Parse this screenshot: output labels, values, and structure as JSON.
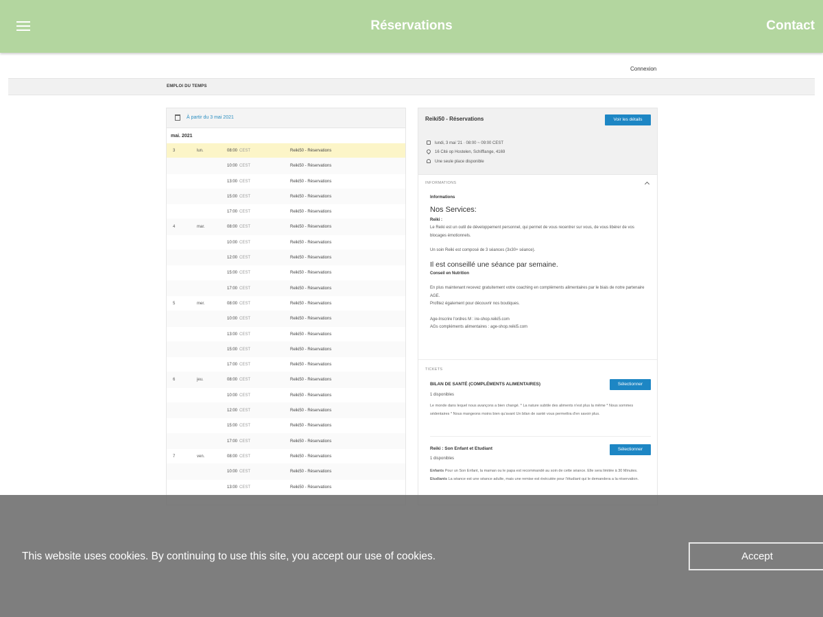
{
  "header": {
    "title": "Réservations",
    "contact": "Contact",
    "menu_icon": "hamburger-menu-icon",
    "background_color": "#b3d69f"
  },
  "topnav": {
    "connexion": "Connexion"
  },
  "subnav": {
    "label": "EMPLOI DU TEMPS"
  },
  "schedule": {
    "from_text": "À partir du 3 mai 2021",
    "month": "mai. 2021",
    "rows": [
      {
        "day": "3",
        "weekday": "lun.",
        "time": "08:00",
        "tz": "CEST",
        "event": "Reiki50 - Réservations"
      },
      {
        "day": "",
        "weekday": "",
        "time": "10:00",
        "tz": "CEST",
        "event": "Reiki50 - Réservations"
      },
      {
        "day": "",
        "weekday": "",
        "time": "13:00",
        "tz": "CEST",
        "event": "Reiki50 - Réservations"
      },
      {
        "day": "",
        "weekday": "",
        "time": "15:00",
        "tz": "CEST",
        "event": "Reiki50 - Réservations"
      },
      {
        "day": "",
        "weekday": "",
        "time": "17:00",
        "tz": "CEST",
        "event": "Reiki50 - Réservations"
      },
      {
        "day": "4",
        "weekday": "mar.",
        "time": "08:00",
        "tz": "CEST",
        "event": "Reiki50 - Réservations"
      },
      {
        "day": "",
        "weekday": "",
        "time": "10:00",
        "tz": "CEST",
        "event": "Reiki50 - Réservations"
      },
      {
        "day": "",
        "weekday": "",
        "time": "12:00",
        "tz": "CEST",
        "event": "Reiki50 - Réservations"
      },
      {
        "day": "",
        "weekday": "",
        "time": "15:00",
        "tz": "CEST",
        "event": "Reiki50 - Réservations"
      },
      {
        "day": "",
        "weekday": "",
        "time": "17:00",
        "tz": "CEST",
        "event": "Reiki50 - Réservations"
      },
      {
        "day": "5",
        "weekday": "mer.",
        "time": "08:00",
        "tz": "CEST",
        "event": "Reiki50 - Réservations"
      },
      {
        "day": "",
        "weekday": "",
        "time": "10:00",
        "tz": "CEST",
        "event": "Reiki50 - Réservations"
      },
      {
        "day": "",
        "weekday": "",
        "time": "13:00",
        "tz": "CEST",
        "event": "Reiki50 - Réservations"
      },
      {
        "day": "",
        "weekday": "",
        "time": "15:00",
        "tz": "CEST",
        "event": "Reiki50 - Réservations"
      },
      {
        "day": "",
        "weekday": "",
        "time": "17:00",
        "tz": "CEST",
        "event": "Reiki50 - Réservations"
      },
      {
        "day": "6",
        "weekday": "jeu.",
        "time": "08:00",
        "tz": "CEST",
        "event": "Reiki50 - Réservations"
      },
      {
        "day": "",
        "weekday": "",
        "time": "10:00",
        "tz": "CEST",
        "event": "Reiki50 - Réservations"
      },
      {
        "day": "",
        "weekday": "",
        "time": "12:00",
        "tz": "CEST",
        "event": "Reiki50 - Réservations"
      },
      {
        "day": "",
        "weekday": "",
        "time": "15:00",
        "tz": "CEST",
        "event": "Reiki50 - Réservations"
      },
      {
        "day": "",
        "weekday": "",
        "time": "17:00",
        "tz": "CEST",
        "event": "Reiki50 - Réservations"
      },
      {
        "day": "7",
        "weekday": "ven.",
        "time": "08:00",
        "tz": "CEST",
        "event": "Reiki50 - Réservations"
      },
      {
        "day": "",
        "weekday": "",
        "time": "10:00",
        "tz": "CEST",
        "event": "Reiki50 - Réservations"
      },
      {
        "day": "",
        "weekday": "",
        "time": "13:00",
        "tz": "CEST",
        "event": "Reiki50 - Réservations"
      }
    ]
  },
  "details": {
    "name": "Reiki50 - Réservations",
    "details_button": "Voir les détails",
    "date": "lundi, 3 mai '21 · 08:00 ~ 09:00 CEST",
    "address": "16 Cité op Hostelen, Schifflange, 4169",
    "places": "Une seule place disponible",
    "info_label": "INFORMATIONS",
    "info_title": "Informations",
    "services_heading": "Nos Services:",
    "reiki_label": "Reiki :",
    "reiki_text": "Le Reiki est un outil de développement personnel, qui permet de vous recentrer sur vous, de vous libérer de vos blocages émotionnels.",
    "cycle_text": "Un soin Reiki est composé de 3 séances (3x30+ séance).",
    "advice_heading": "Il est conseillé une séance par semaine.",
    "nutrition_label": "Conseil en Nutrition",
    "nutrition_text1": "En plus maintenant recevez gratuitement votre coaching en compléments alimentaires par le biais de notre partenaire AGE.",
    "nutrition_text2": "Profitez également pour découvrir nos boutiques.",
    "shop_text1": "Age-Inscrire l'ordres M : ire-shop.reiki5.com",
    "shop_text2": "AGs compléments alimentaires : age-shop.reiki5.com",
    "tickets_label": "TICKETS",
    "tickets": [
      {
        "title": "BILAN DE SANTÉ (COMPLÉMENTS ALIMENTAIRES)",
        "button": "Sélectionner",
        "avail": "1 disponibles",
        "desc": "Le monde dans lequel nous avançons a bien changé. * La nature subtile des aliments n'est plus la même * Nous sommes sédentaires * Nous mangeons moins bien qu'avant Un bilan de santé vous permettra d'en savoir plus."
      },
      {
        "title": "Reiki : Son Enfant et Etudiant",
        "button": "Sélectionner",
        "avail": "1 disponibles",
        "desc_enfant_label": "Enfants",
        "desc_enfant": "Pour un Son Enfant, la maman ou le papa est recommandé au soin de cette séance. Elle sera limitée à 30 Minutes.",
        "desc_etudiant_label": "Etudiants",
        "desc_etudiant": "La séance est une séance adulte, mais une remise est éxécutée pour l'étudiant qui le demandera a la réservation."
      }
    ]
  },
  "cookie": {
    "message": "This website uses cookies. By continuing to use this site, you accept our use of cookies.",
    "accept": "Accept"
  }
}
